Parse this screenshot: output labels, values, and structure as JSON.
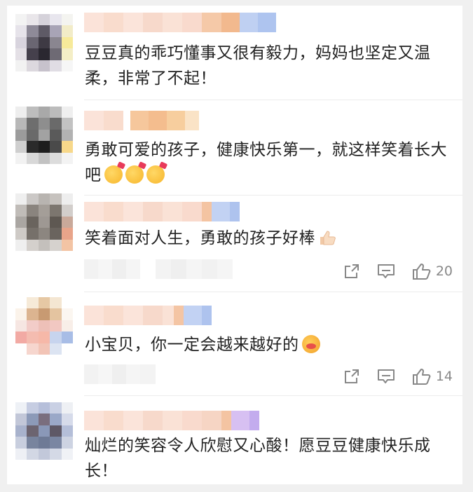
{
  "comments": [
    {
      "text": "豆豆真的乖巧懂事又很有毅力，妈妈也坚定又温柔，非常了不起！"
    },
    {
      "text": "勇敢可爱的孩子，健康快乐第一，就这样笑着长大吧",
      "emojis": [
        "party-face",
        "party-face",
        "party-face"
      ]
    },
    {
      "text": "笑着面对人生，勇敢的孩子好棒",
      "emojis": [
        "thumbs-up"
      ],
      "likes": "20"
    },
    {
      "text": "小宝贝，你一定会越来越好的",
      "emojis": [
        "blush-kiss-face"
      ],
      "likes": "14"
    },
    {
      "text": "灿烂的笑容令人欣慰又心酸！愿豆豆健康快乐成长！"
    }
  ],
  "colors": {
    "like_gray": "#888888",
    "mosaic_peach": "#f7cdb8",
    "mosaic_blue": "#b7c9f2"
  }
}
